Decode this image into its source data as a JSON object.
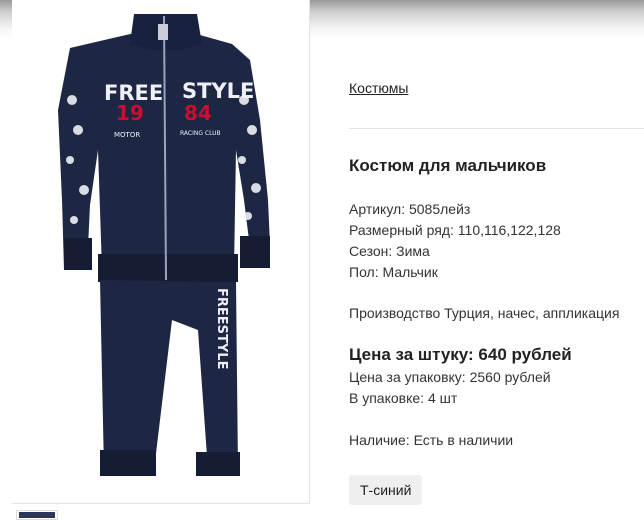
{
  "breadcrumb": {
    "category": "Костюмы"
  },
  "product": {
    "title": "Костюм для мальчиков",
    "specs": [
      {
        "label": "Артикул:",
        "value": "5085лейз"
      },
      {
        "label": "Размерный ряд:",
        "value": "110,116,122,128"
      },
      {
        "label": "Сезон:",
        "value": "Зима"
      },
      {
        "label": "Пол:",
        "value": "Мальчик"
      }
    ],
    "description": "Производство Турция, начес, аппликация",
    "price_per_item": "Цена за штуку: 640 рублей",
    "price_per_pack": "Цена за упаковку: 2560 рублей",
    "pack_quantity": "В упаковке: 4 шт",
    "availability": "Наличие: Есть в наличии",
    "variant": "Т-синий"
  },
  "image": {
    "print_word_1": "FREE",
    "print_word_2": "STYLE",
    "print_year_1": "19",
    "print_year_2": "84",
    "print_motor": "MOTOR",
    "print_racing": "RACING CLUB",
    "pants_print": "FREESTYLE"
  },
  "colors": {
    "garment": "#1d2744",
    "garment_dark": "#151d35",
    "print_red": "#c8102e",
    "print_white": "#eef0f5"
  }
}
